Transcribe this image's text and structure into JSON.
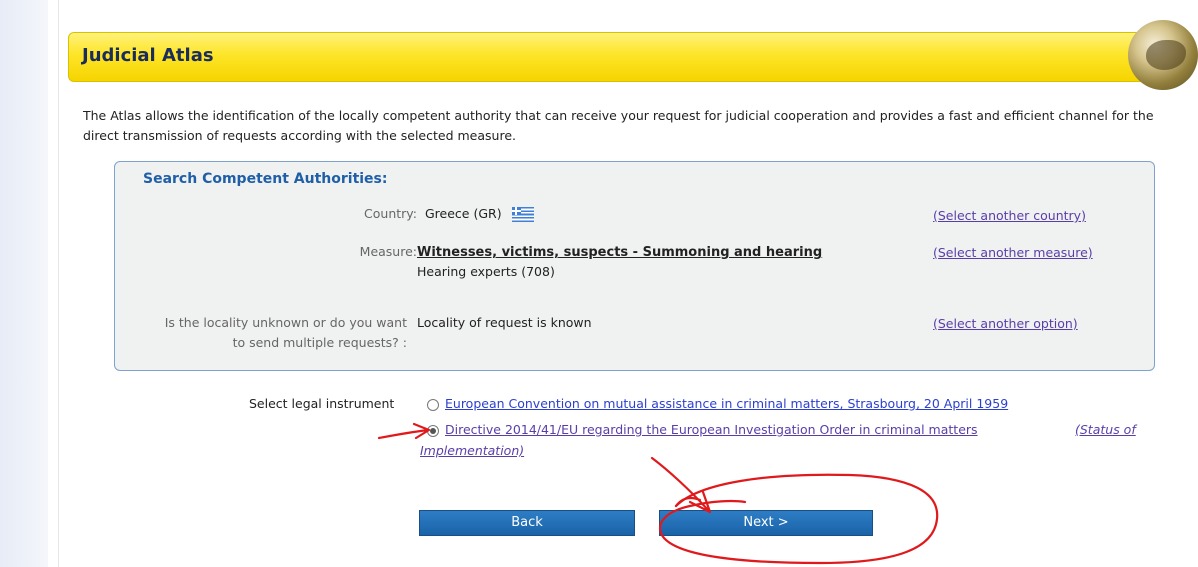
{
  "header": {
    "title": "Judicial Atlas"
  },
  "intro": "The Atlas allows the identification of the locally competent authority that can receive your request for judicial cooperation and provides a fast and efficient channel for the direct transmission of requests according with the selected measure.",
  "search": {
    "title": "Search Competent Authorities:",
    "country": {
      "label": "Country:",
      "value": "Greece (GR)",
      "link": "(Select another country)"
    },
    "measure": {
      "label": "Measure:",
      "value": "Witnesses, victims, suspects - Summoning and hearing",
      "sub": "Hearing experts (708)",
      "link": "(Select another measure)"
    },
    "locality": {
      "label_line1": "Is the locality unknown or do you want",
      "label_line2": "to send multiple requests? :",
      "value": "Locality of request is known",
      "link": "(Select another option)"
    }
  },
  "legal": {
    "label": "Select legal instrument",
    "option1": "European Convention on mutual assistance in criminal matters, Strasbourg, 20 April 1959",
    "option2": "Directive 2014/41/EU regarding the European Investigation Order in criminal matters",
    "status_part1": "(Status of",
    "status_part2": "Implementation)",
    "selected": 2
  },
  "buttons": {
    "back": "Back",
    "next": "Next >"
  },
  "colors": {
    "title_bar": "#fde528",
    "button": "#1f6db5",
    "annotation": "#e0191c"
  },
  "icons": {
    "flag": "greece-flag-icon",
    "globe": "globe-icon"
  }
}
